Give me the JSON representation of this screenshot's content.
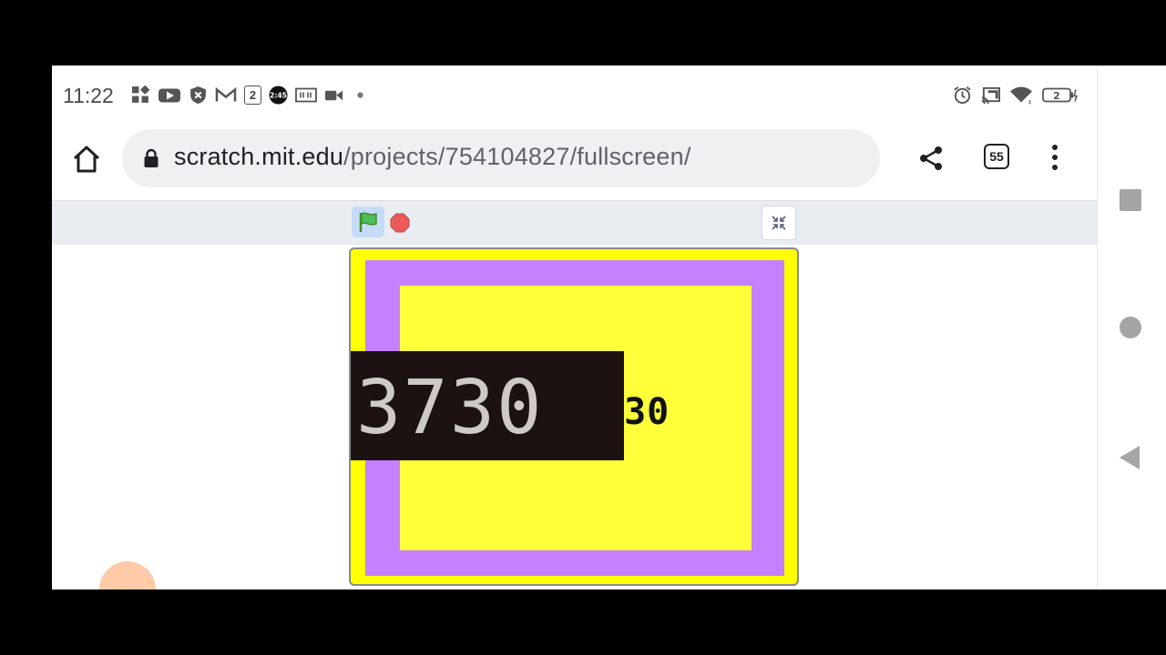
{
  "status_bar": {
    "time": "11:22",
    "left_icons": [
      "widget-icon",
      "youtube-icon",
      "shield-x-icon",
      "gmail-icon",
      "2",
      "clock-app-icon",
      "media-icon",
      "video-icon",
      "dot"
    ],
    "right_icons": [
      "alarm-icon",
      "cast-icon",
      "wifi-icon",
      "battery-icon"
    ],
    "notif_count": "2",
    "battery_level": "2"
  },
  "browser": {
    "url_host": "scratch.mit.edu",
    "url_path": "/projects/754104827/fullscreen/",
    "tab_count": "55"
  },
  "stage": {
    "score_display": "730",
    "overlay_number": "3730",
    "colors": {
      "outer": "#ffff00",
      "frame": "#c580ff",
      "inner": "#ffff3a"
    }
  }
}
